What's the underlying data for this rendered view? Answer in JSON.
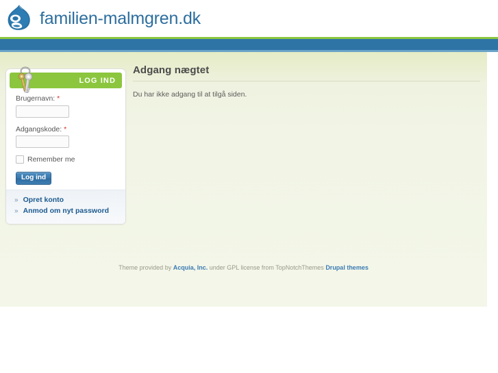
{
  "site": {
    "name": "familien-malmgren.dk",
    "logo_icon": "drupal-drop-icon"
  },
  "colors": {
    "green_accent": "#8cc63e",
    "blue_bar": "#2e74a5",
    "link_blue": "#1d5a8f",
    "title_text": "#4b4b4b",
    "required_red": "#d0342c",
    "page_bg": "#f2f5e6"
  },
  "login_block": {
    "title": "LOG IND",
    "icon": "keys-icon",
    "username": {
      "label": "Brugernavn:",
      "required_marker": "*",
      "value": "",
      "placeholder": ""
    },
    "password": {
      "label": "Adgangskode:",
      "required_marker": "*",
      "value": "",
      "placeholder": ""
    },
    "remember": {
      "label": "Remember me",
      "checked": false
    },
    "submit_label": "Log ind",
    "links": [
      {
        "bullet": "»",
        "label": "Opret konto"
      },
      {
        "bullet": "»",
        "label": "Anmod om nyt password"
      }
    ]
  },
  "main": {
    "title": "Adgang nægtet",
    "message": "Du har ikke adgang til at tilgå siden."
  },
  "footer": {
    "prefix": "Theme provided by ",
    "link1": "Acquia, Inc.",
    "middle": " under GPL license from TopNotchThemes ",
    "link2": "Drupal themes"
  }
}
